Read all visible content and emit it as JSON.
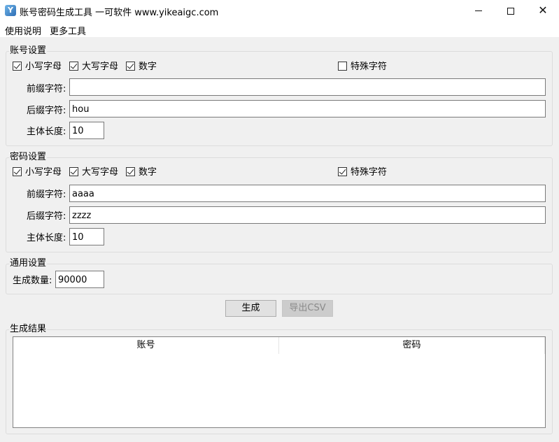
{
  "window": {
    "title": "账号密码生成工具 一可软件 www.yikeaigc.com",
    "icon": "app-logo-icon"
  },
  "menu": {
    "items": [
      {
        "label": "使用说明"
      },
      {
        "label": "更多工具"
      }
    ]
  },
  "account_settings": {
    "title": "账号设置",
    "options": [
      {
        "label": "小写字母",
        "checked": true
      },
      {
        "label": "大写字母",
        "checked": true
      },
      {
        "label": "数字",
        "checked": true
      },
      {
        "label": "特殊字符",
        "checked": false
      }
    ],
    "prefix_label": "前缀字符:",
    "prefix_value": "",
    "suffix_label": "后缀字符:",
    "suffix_value": "hou",
    "length_label": "主体长度:",
    "length_value": "10"
  },
  "password_settings": {
    "title": "密码设置",
    "options": [
      {
        "label": "小写字母",
        "checked": true
      },
      {
        "label": "大写字母",
        "checked": true
      },
      {
        "label": "数字",
        "checked": true
      },
      {
        "label": "特殊字符",
        "checked": true
      }
    ],
    "prefix_label": "前缀字符:",
    "prefix_value": "aaaa",
    "suffix_label": "后缀字符:",
    "suffix_value": "zzzz",
    "length_label": "主体长度:",
    "length_value": "10"
  },
  "general_settings": {
    "title": "通用设置",
    "count_label": "生成数量:",
    "count_value": "90000"
  },
  "actions": {
    "generate_label": "生成",
    "export_label": "导出CSV",
    "export_enabled": false
  },
  "results": {
    "title": "生成结果",
    "columns": [
      "账号",
      "密码"
    ],
    "rows": []
  }
}
